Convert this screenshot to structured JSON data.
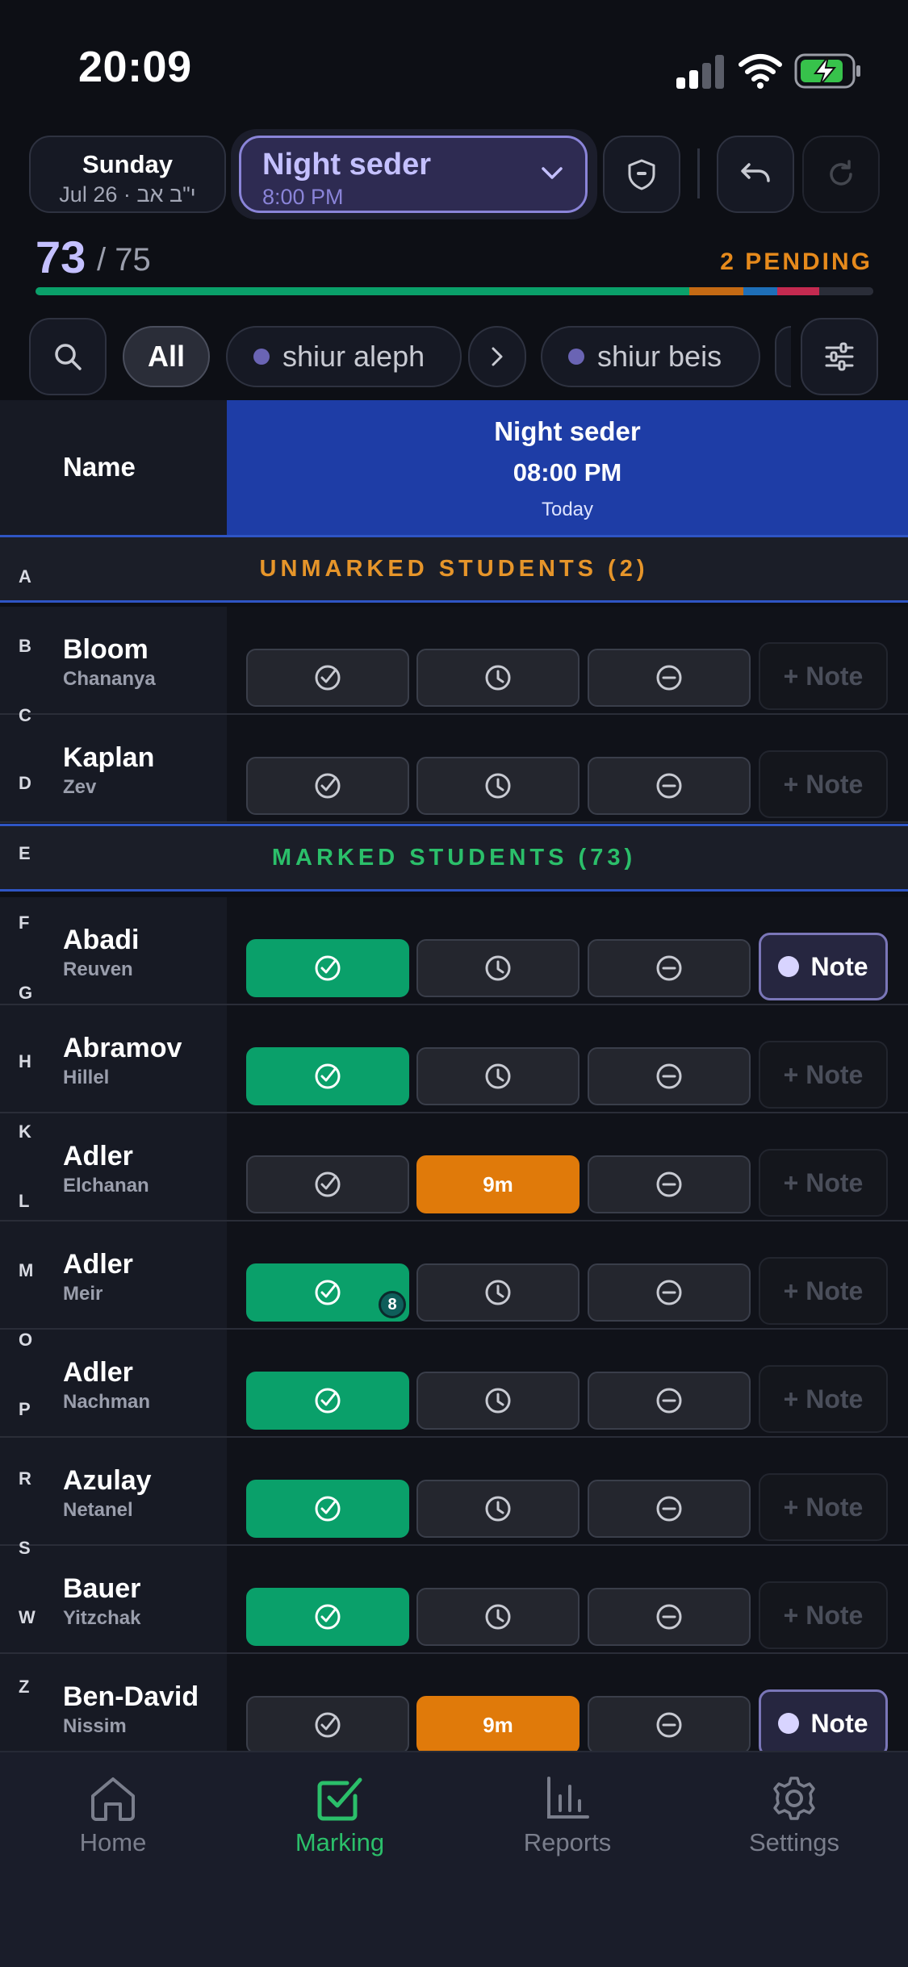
{
  "status_bar": {
    "time": "20:09"
  },
  "header": {
    "date_day": "Sunday",
    "date_sub": "Jul 26 · י\"ב אב",
    "session_title": "Night seder",
    "session_time": "8:00 PM"
  },
  "progress": {
    "marked": "73",
    "total": "/ 75",
    "pending_label": "2 PENDING",
    "segments": [
      {
        "status": "present",
        "fraction": 0.78,
        "color": "#0aa06a"
      },
      {
        "status": "late",
        "fraction": 0.065,
        "color": "#c46a14"
      },
      {
        "status": "excused",
        "fraction": 0.04,
        "color": "#1e6fb8"
      },
      {
        "status": "absent",
        "fraction": 0.05,
        "color": "#c42a50"
      },
      {
        "status": "unmarked",
        "fraction": 0.065,
        "color": "#2a2d38"
      }
    ]
  },
  "filters": {
    "all": "All",
    "groups": [
      "shiur aleph",
      "shiur beis"
    ]
  },
  "table_header": {
    "name": "Name",
    "session_title": "Night seder",
    "session_time": "08:00 PM",
    "session_day": "Today"
  },
  "sections": {
    "unmarked": "UNMARKED STUDENTS (2)",
    "marked": "MARKED STUDENTS (73)"
  },
  "note_labels": {
    "empty": "+ Note",
    "filled": "Note"
  },
  "students": [
    {
      "last": "Bloom",
      "first": "Chananya",
      "status": "unmarked",
      "late": "",
      "badge": "",
      "note": false
    },
    {
      "last": "Kaplan",
      "first": "Zev",
      "status": "unmarked",
      "late": "",
      "badge": "",
      "note": false
    },
    {
      "last": "Abadi",
      "first": "Reuven",
      "status": "present",
      "late": "",
      "badge": "",
      "note": true
    },
    {
      "last": "Abramov",
      "first": "Hillel",
      "status": "present",
      "late": "",
      "badge": "",
      "note": false
    },
    {
      "last": "Adler",
      "first": "Elchanan",
      "status": "late",
      "late": "9m",
      "badge": "",
      "note": false
    },
    {
      "last": "Adler",
      "first": "Meir",
      "status": "present",
      "late": "",
      "badge": "8",
      "note": false
    },
    {
      "last": "Adler",
      "first": "Nachman",
      "status": "present",
      "late": "",
      "badge": "",
      "note": false
    },
    {
      "last": "Azulay",
      "first": "Netanel",
      "status": "present",
      "late": "",
      "badge": "",
      "note": false
    },
    {
      "last": "Bauer",
      "first": "Yitzchak",
      "status": "present",
      "late": "",
      "badge": "",
      "note": false
    },
    {
      "last": "Ben-David",
      "first": "Nissim",
      "status": "late",
      "late": "9m",
      "badge": "",
      "note": true
    }
  ],
  "alphabet": [
    "A",
    "B",
    "C",
    "D",
    "E",
    "F",
    "G",
    "H",
    "K",
    "L",
    "M",
    "O",
    "P",
    "R",
    "S",
    "W",
    "Z"
  ],
  "tabs": [
    {
      "label": "Home",
      "icon": "home-icon",
      "active": false
    },
    {
      "label": "Marking",
      "icon": "checkbox-icon",
      "active": true
    },
    {
      "label": "Reports",
      "icon": "bar-chart-icon",
      "active": false
    },
    {
      "label": "Settings",
      "icon": "gear-icon",
      "active": false
    }
  ]
}
